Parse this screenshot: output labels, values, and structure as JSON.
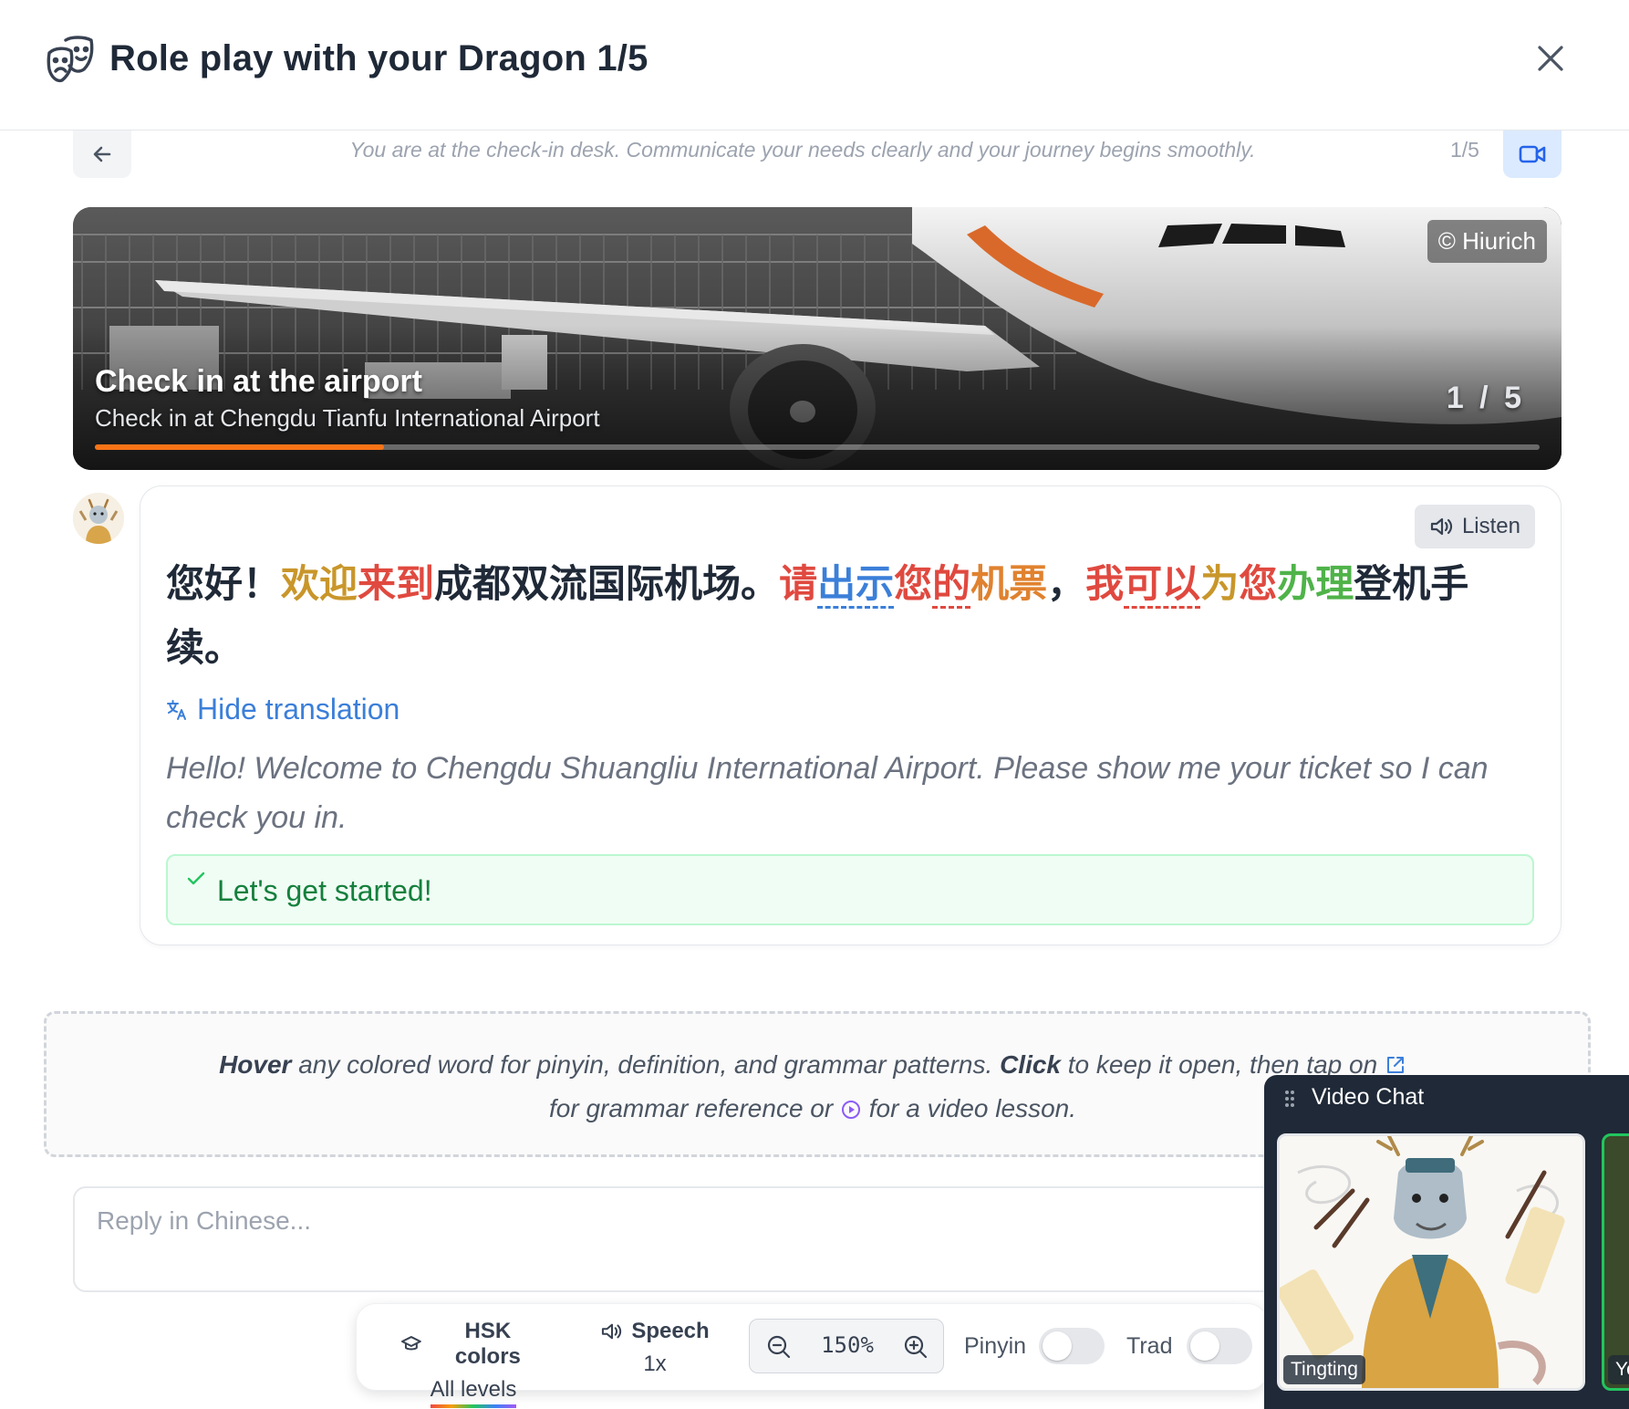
{
  "header": {
    "title": "Role play with your Dragon 1/5"
  },
  "scenario": {
    "text": "You are at the check-in desk. Communicate your needs clearly and your journey begins smoothly.",
    "count": "1/5"
  },
  "banner": {
    "credit": "© Hiurich",
    "title": "Check in at the airport",
    "subtitle": "Check in at Chengdu Tianfu International Airport",
    "count": "1 / 5",
    "progress_percent": 20
  },
  "message": {
    "listen_label": "Listen",
    "chinese_segments": [
      {
        "text": "您好！",
        "color": "#1f2937",
        "underline": false
      },
      {
        "text": "欢迎",
        "color": "#c9962a",
        "underline": false
      },
      {
        "text": "来到",
        "color": "#e0493f",
        "underline": false
      },
      {
        "text": "成都双流国际机场。",
        "color": "#1f2937",
        "underline": false
      },
      {
        "text": "请",
        "color": "#e0493f",
        "underline": false
      },
      {
        "text": "出示",
        "color": "#3b7fd9",
        "underline": true
      },
      {
        "text": "您",
        "color": "#e0493f",
        "underline": false
      },
      {
        "text": "的",
        "color": "#e0493f",
        "underline": true
      },
      {
        "text": "机票",
        "color": "#e0822f",
        "underline": false
      },
      {
        "text": "，",
        "color": "#1f2937",
        "underline": false
      },
      {
        "text": "我",
        "color": "#e0493f",
        "underline": false
      },
      {
        "text": "可以",
        "color": "#e0493f",
        "underline": true
      },
      {
        "text": "为",
        "color": "#c9962a",
        "underline": false
      },
      {
        "text": "您",
        "color": "#e0493f",
        "underline": false
      },
      {
        "text": "办理",
        "color": "#4fb349",
        "underline": false
      },
      {
        "text": "登机手续。",
        "color": "#1f2937",
        "underline": false
      }
    ],
    "toggle_translation_label": "Hide translation",
    "translation": "Hello! Welcome to Chengdu Shuangliu International Airport. Please show me your ticket so I can check you in.",
    "success_message": "Let's get started!"
  },
  "hint": {
    "hover_word": "Hover",
    "part1": " any colored word for pinyin, definition, and grammar patterns. ",
    "click_word": "Click",
    "part2": " to keep it open, then tap on ",
    "part3": " for grammar reference or ",
    "part4": " for a video lesson."
  },
  "reply": {
    "placeholder": "Reply in Chinese..."
  },
  "toolbar": {
    "hsk_label": "HSK colors",
    "hsk_value": "All levels",
    "speech_label": "Speech",
    "speech_value": "1x",
    "zoom_value": "150%",
    "pinyin_label": "Pinyin",
    "trad_label": "Trad"
  },
  "video_chat": {
    "title": "Video Chat",
    "self_name": "Tingting",
    "other_name": "Yo"
  },
  "colors": {
    "accent_blue": "#3b7fd9",
    "success_green": "#15803d",
    "progress_orange": "#f97316"
  },
  "icons": [
    "theater-mask-icon",
    "close-icon",
    "arrow-left-icon",
    "video-camera-icon",
    "speaker-icon",
    "translate-icon",
    "check-icon",
    "external-link-icon",
    "play-circle-icon",
    "graduation-cap-icon",
    "zoom-out-icon",
    "zoom-in-icon",
    "drag-handle-icon"
  ]
}
